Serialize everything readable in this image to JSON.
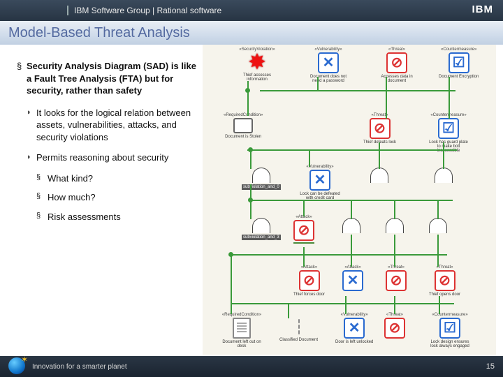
{
  "header": {
    "org": "IBM Software Group | Rational software",
    "logo": "IBM"
  },
  "title": "Model-Based Threat Analysis",
  "bullets": {
    "main": "Security Analysis Diagram (SAD) is like a Fault Tree Analysis (FTA) but for security, rather than safety",
    "sub1": "It looks for the logical relation between assets, vulnerabilities, attacks, and security violations",
    "sub2": "Permits reasoning about security",
    "s2a": "What kind?",
    "s2b": "How much?",
    "s2c": "Risk assessments"
  },
  "nodes": {
    "n1": {
      "ster": "«SecurityViolation»",
      "cap": "Thief accesses information"
    },
    "n2": {
      "ster": "«Vulnerability»",
      "cap": "Document does not need a password"
    },
    "n3": {
      "ster": "«Threat»",
      "cap": "Accesses data in document"
    },
    "n4": {
      "ster": "«Countermeasure»",
      "cap": "Document Encryption"
    },
    "n5": {
      "ster": "«RequiredCondition»",
      "cap": "Document is Stolen"
    },
    "n6": {
      "ster": "«Threat»",
      "cap": "Thief defeats lock"
    },
    "n7": {
      "ster": "«Countermeasure»",
      "cap": "Lock has guard plate to make bolt inaccessible"
    },
    "n8": {
      "ster": "«Vulnerability»",
      "cap": "Lock can be defeated with credit card"
    },
    "g1": {
      "cap": "subviolation_and_0"
    },
    "g2": {
      "cap": "subviolation_and_3"
    },
    "g3": {
      "cap": ""
    },
    "g4": {
      "cap": ""
    },
    "n9": {
      "ster": "«Attack»",
      "cap": ""
    },
    "n10": {
      "ster": "«Attack»",
      "cap": "Thief forces door"
    },
    "n11": {
      "ster": "«Threat»",
      "cap": "Thief opens door"
    },
    "n12": {
      "ster": "«RequiredCondition»",
      "cap": "Document left out on desk"
    },
    "srv": {
      "cap": "Classified Document"
    },
    "n13": {
      "ster": "«Vulnerability»",
      "cap": "Door is left unlocked"
    },
    "n14": {
      "ster": "«Countermeasure»",
      "cap": "Lock design ensures lock always engaged"
    }
  },
  "footer": {
    "tag": "Innovation for a smarter planet",
    "page": "15"
  }
}
